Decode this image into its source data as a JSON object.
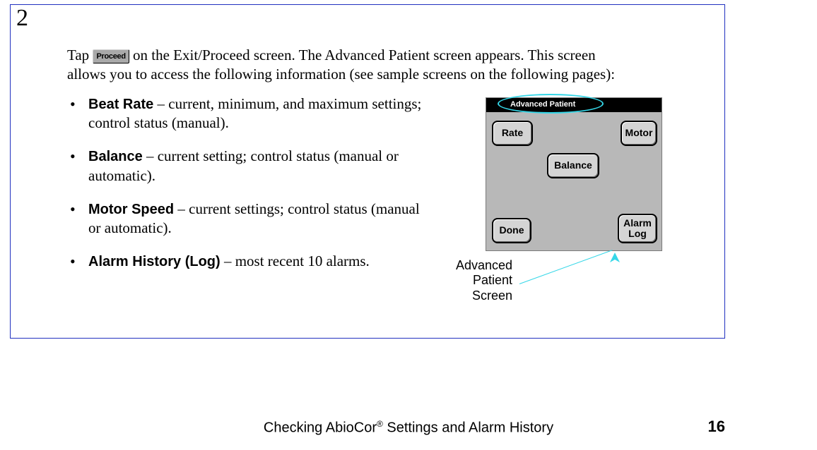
{
  "step_number": "2",
  "intro": {
    "part1": "Tap ",
    "button_label": "Proceed",
    "part2": " on the Exit/Proceed screen. The Advanced Patient screen appears. This screen allows you to access the following information (see sample screens on the following pages):"
  },
  "bullets": [
    {
      "title": "Beat Rate",
      "desc": " – current, minimum, and maximum settings; control status (manual)."
    },
    {
      "title": "Balance",
      "desc": " – current setting; control status (manual or automatic)."
    },
    {
      "title": "Motor Speed",
      "desc": " – current settings; control status (manual or automatic)."
    },
    {
      "title": "Alarm History (Log)",
      "desc": " – most recent 10 alarms."
    }
  ],
  "device": {
    "header": "Advanced Patient",
    "buttons": {
      "rate": "Rate",
      "motor": "Motor",
      "balance": "Balance",
      "done": "Done",
      "alarm_log": "Alarm\nLog"
    }
  },
  "caption": "Advanced\nPatient\nScreen",
  "footer": {
    "title_before": "Checking AbioCor",
    "title_sup": "®",
    "title_after": " Settings and Alarm History",
    "page": "16"
  }
}
